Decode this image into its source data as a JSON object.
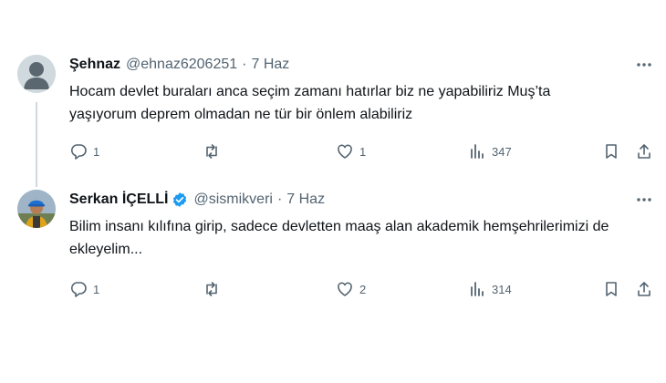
{
  "tweets": [
    {
      "name": "Şehnaz",
      "handle": "@ehnaz6206251",
      "separator": "·",
      "date": "7 Haz",
      "verified": false,
      "avatar": "default-avatar",
      "text": "Hocam devlet buraları anca seçim zamanı hatırlar biz ne yapabiliriz Muş’ta yaşıyorum deprem olmadan ne tür bir önlem alabiliriz",
      "replies": "1",
      "reposts": "",
      "likes": "1",
      "views": "347"
    },
    {
      "name": "Serkan İÇELLİ",
      "handle": "@sismikveri",
      "separator": "·",
      "date": "7 Haz",
      "verified": true,
      "avatar": "profile-photo",
      "text": "Bilim insanı kılıfına girip, sadece devletten maaş alan akademik hemşehrilerimizi de ekleyelim...",
      "replies": "1",
      "reposts": "",
      "likes": "2",
      "views": "314"
    }
  ],
  "colors": {
    "text": "#0f1419",
    "secondary": "#536471",
    "verified": "#1d9bf0",
    "thread_line": "#cfd9de"
  }
}
